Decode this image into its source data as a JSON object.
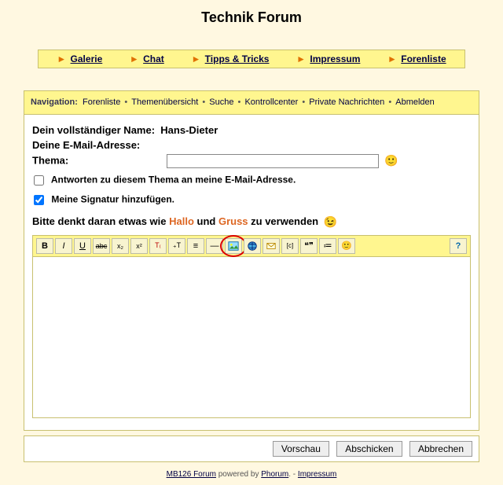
{
  "title": "Technik Forum",
  "topnav": [
    {
      "label": "Galerie"
    },
    {
      "label": "Chat"
    },
    {
      "label": "Tipps & Tricks"
    },
    {
      "label": "Impressum"
    },
    {
      "label": "Forenliste"
    }
  ],
  "navigation": {
    "label": "Navigation:",
    "items": [
      "Forenliste",
      "Themenübersicht",
      "Suche",
      "Kontrollcenter",
      "Private Nachrichten",
      "Abmelden"
    ]
  },
  "form": {
    "name_label": "Dein vollständiger Name:",
    "name_value": "Hans-Dieter",
    "email_label": "Deine E-Mail-Adresse:",
    "subject_label": "Thema:",
    "subject_value": "",
    "check1_label": "Antworten zu diesem Thema an meine E-Mail-Adresse.",
    "check1_checked": false,
    "check2_label": "Meine Signatur hinzufügen.",
    "check2_checked": true,
    "reminder_pre": "Bitte denkt daran etwas wie ",
    "reminder_hallo": "Hallo",
    "reminder_mid": " und ",
    "reminder_gruss": "Gruss",
    "reminder_post": " zu verwenden "
  },
  "toolbar": {
    "bold": "B",
    "italic": "I",
    "underline": "U",
    "strike": "abc",
    "sub": "x₂",
    "sup": "x²",
    "color": "T₍",
    "size": "₊T",
    "center": "≡",
    "hr": "—",
    "image": "img",
    "url": "🔗",
    "email": "✉",
    "code": "[c]",
    "quote": "❝❞",
    "list": "≔",
    "smiley": "🙂",
    "help": "?"
  },
  "buttons": {
    "preview": "Vorschau",
    "submit": "Abschicken",
    "cancel": "Abbrechen"
  },
  "footer": {
    "forumlink": "MB126 Forum",
    "powered": " powered by ",
    "phorum": "Phorum",
    "dot": ". - ",
    "impressum": "Impressum"
  }
}
